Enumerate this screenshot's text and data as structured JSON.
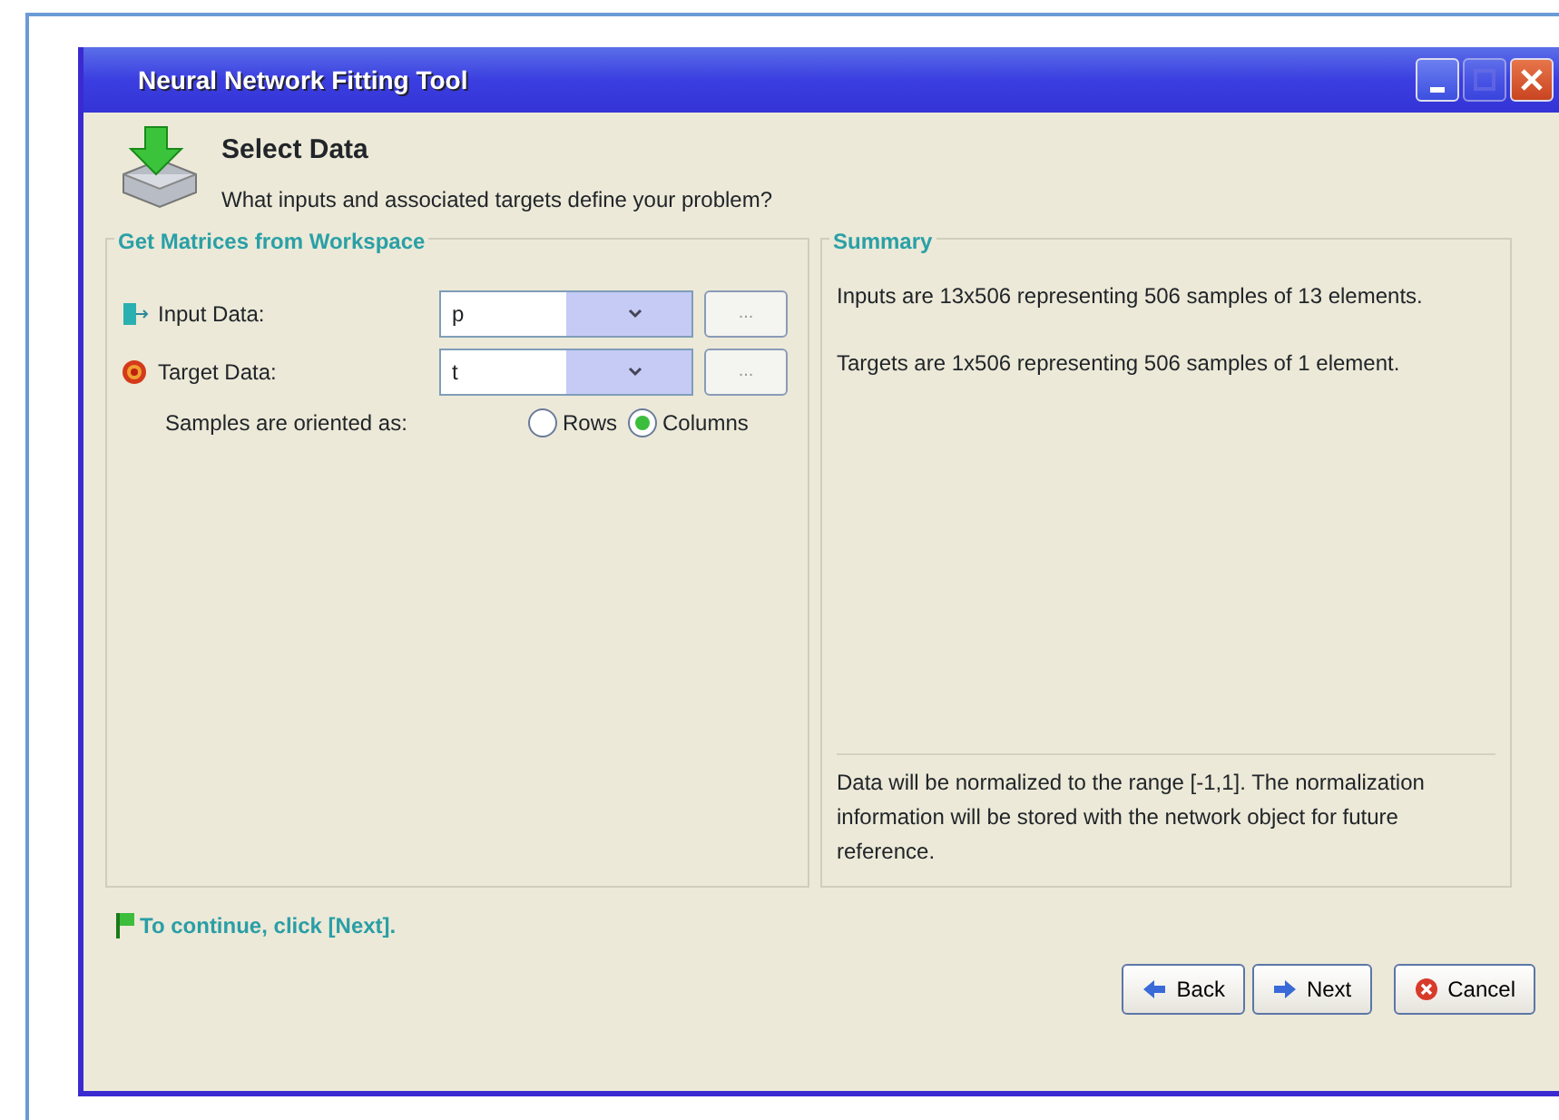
{
  "window": {
    "title": "Neural Network Fitting Tool",
    "controls": [
      {
        "kind": "minimize",
        "disabled": false
      },
      {
        "kind": "maximize",
        "disabled": true
      },
      {
        "kind": "close",
        "disabled": false
      }
    ]
  },
  "header": {
    "title": "Select Data",
    "subtitle": "What inputs and associated targets define your problem?"
  },
  "matrices": {
    "title": "Get Matrices from Workspace",
    "fields": [
      {
        "kind": "input",
        "label": "Input Data:",
        "value": "p",
        "browse": "..."
      },
      {
        "kind": "target",
        "label": "Target Data:",
        "value": "t",
        "browse": "..."
      }
    ],
    "orientation": {
      "label": "Samples are oriented as:",
      "options": [
        {
          "label": "Rows",
          "selected": false
        },
        {
          "label": "Columns",
          "selected": true
        }
      ]
    }
  },
  "summary": {
    "title": "Summary",
    "lines": [
      "Inputs are 13x506 representing 506 samples of 13 elements.",
      "Targets are 1x506 representing 506 samples of 1 element."
    ],
    "note": "Data will be normalized to the range [-1,1]. The normalization information will be stored with the network object for future reference."
  },
  "hint": "To continue, click [Next].",
  "buttons": [
    {
      "kind": "back",
      "label": "Back"
    },
    {
      "kind": "next",
      "label": "Next"
    },
    {
      "kind": "cancel",
      "label": "Cancel"
    }
  ]
}
